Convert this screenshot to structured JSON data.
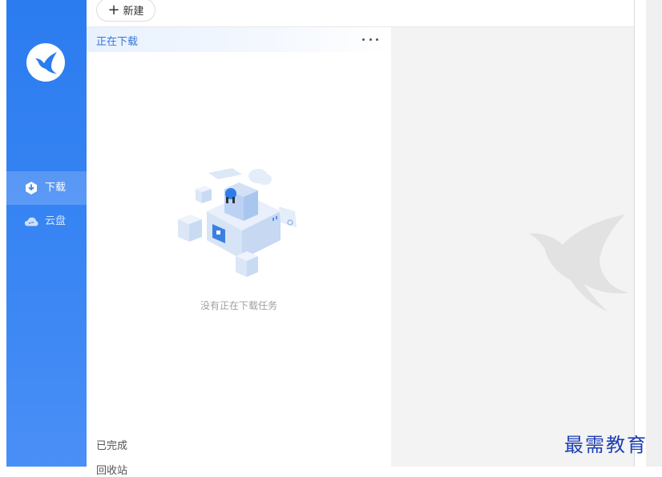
{
  "sidebar": {
    "items": [
      {
        "label": "下载",
        "icon": "download-icon",
        "active": true
      },
      {
        "label": "云盘",
        "icon": "cloud-icon",
        "active": false
      }
    ],
    "logo": "bird-logo-icon"
  },
  "toolbar": {
    "new_label": "新建"
  },
  "downloads": {
    "section_title": "正在下载",
    "empty_message": "没有正在下载任务",
    "completed_label": "已完成",
    "trash_label": "回收站"
  },
  "watermark": {
    "text": "最需教育"
  },
  "colors": {
    "sidebar": "#2b7cf0",
    "accent": "#3477d9",
    "detail_bg": "#f3f3f3"
  }
}
